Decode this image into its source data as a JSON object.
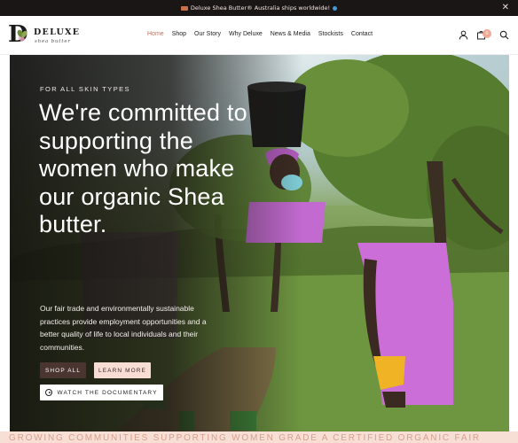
{
  "announcement": {
    "text": "Deluxe Shea Butter® Australia ships worldwide!",
    "close_glyph": "✕"
  },
  "brand": {
    "letter": "D",
    "name": "DELUXE",
    "tagline": "shea butter"
  },
  "nav": {
    "items": [
      {
        "label": "Home",
        "active": true
      },
      {
        "label": "Shop",
        "active": false
      },
      {
        "label": "Our Story",
        "active": false
      },
      {
        "label": "Why Deluxe",
        "active": false
      },
      {
        "label": "News & Media",
        "active": false
      },
      {
        "label": "Stockists",
        "active": false
      },
      {
        "label": "Contact",
        "active": false
      }
    ],
    "icons": [
      "account-icon",
      "cart-icon",
      "search-icon"
    ],
    "cart_count": "0"
  },
  "hero": {
    "tag": "FOR ALL SKIN TYPES",
    "heading": "We're committed to supporting the women who make our organic Shea butter.",
    "description": "Our fair trade and environmentally sustainable practices provide employment opportunities and a better quality of life to local individuals and their communities.",
    "buttons": {
      "shop_all": "SHOP ALL",
      "learn_more": "LEARN MORE",
      "watch": "WATCH THE DOCUMENTARY"
    }
  },
  "marquee": {
    "text": "GROWING COMMUNITIES   SUPPORTING WOMEN   GRADE A   CERTIFIED ORGANIC   FAIR"
  },
  "colors": {
    "accent": "#c2725c",
    "announcement_bg": "#1b1616",
    "button_dark": "#4b3530",
    "button_light": "#f8ddd5",
    "marquee_bg": "#f7dfd6"
  }
}
